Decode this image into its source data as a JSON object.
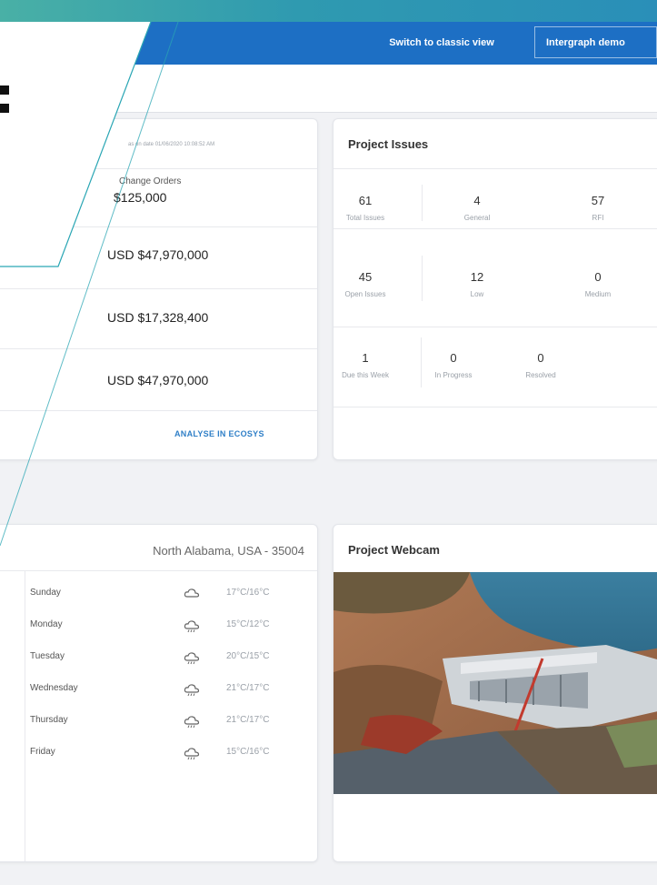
{
  "header": {
    "switch_label": "Switch to classic view",
    "account_label": "Intergraph demo"
  },
  "budget_card": {
    "timestamp_prefix": "as on date",
    "timestamp": "01/06/2020 10:08:52 AM",
    "change_orders_label": "Change Orders",
    "change_orders_value": "$125,000",
    "values": [
      "USD $47,970,000",
      "USD $17,328,400",
      "USD $47,970,000"
    ],
    "link_label": "ANALYSE IN ECOSYS"
  },
  "issues_card": {
    "title": "Project Issues",
    "rows": [
      [
        {
          "value": "61",
          "label": "Total Issues"
        },
        {
          "value": "4",
          "label": "General"
        },
        {
          "value": "57",
          "label": "RFI"
        }
      ],
      [
        {
          "value": "45",
          "label": "Open Issues"
        },
        {
          "value": "12",
          "label": "Low"
        },
        {
          "value": "0",
          "label": "Medium"
        }
      ],
      [
        {
          "value": "1",
          "label": "Due this Week"
        },
        {
          "value": "0",
          "label": "In Progress"
        },
        {
          "value": "0",
          "label": "Resolved"
        }
      ]
    ]
  },
  "weather_card": {
    "location": "North Alabama, USA - 35004",
    "forecast": [
      {
        "day": "Sunday",
        "icon": "cloud-icon",
        "temp": "17°C/16°C"
      },
      {
        "day": "Monday",
        "icon": "rain-cloud-icon",
        "temp": "15°C/12°C"
      },
      {
        "day": "Tuesday",
        "icon": "rain-cloud-icon",
        "temp": "20°C/15°C"
      },
      {
        "day": "Wednesday",
        "icon": "rain-cloud-icon",
        "temp": "21°C/17°C"
      },
      {
        "day": "Thursday",
        "icon": "rain-cloud-icon",
        "temp": "21°C/17°C"
      },
      {
        "day": "Friday",
        "icon": "rain-cloud-icon",
        "temp": "15°C/16°C"
      }
    ]
  },
  "webcam_card": {
    "title": "Project Webcam"
  },
  "colors": {
    "topbar": "#1d6fc4",
    "accent_teal": "#2aa6b4",
    "link_blue": "#2f7fc7"
  }
}
